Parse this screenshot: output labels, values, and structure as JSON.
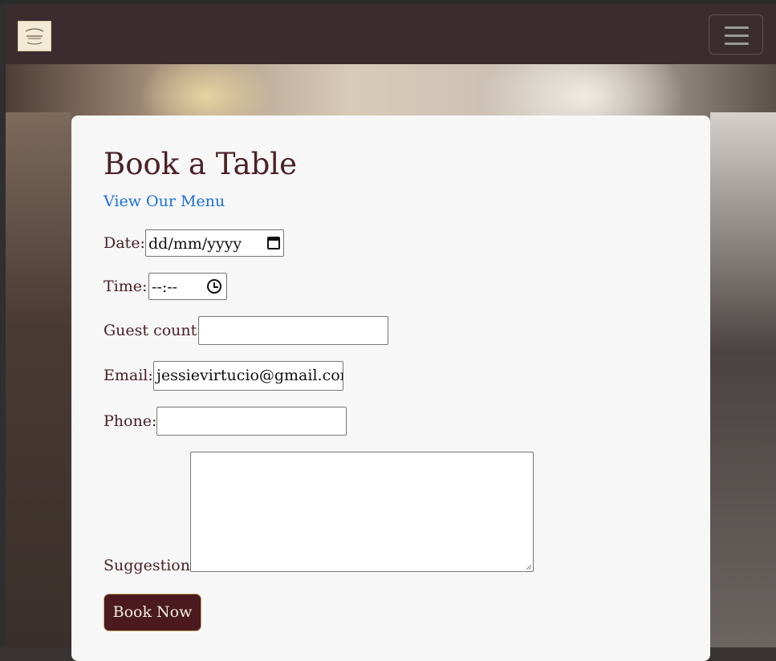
{
  "page": {
    "title": "Book a Table",
    "menu_link": "View Our Menu"
  },
  "navbar": {
    "logo_icon": "restaurant-logo-icon",
    "toggler_icon": "hamburger-menu-icon"
  },
  "form": {
    "date": {
      "label": "Date:",
      "placeholder": "dd/mm/yyyy"
    },
    "time": {
      "label": "Time:",
      "placeholder": "--:--"
    },
    "guest_count": {
      "label": "Guest count:",
      "value": ""
    },
    "email": {
      "label": "Email:",
      "value": "jessievirtucio@gmail.com"
    },
    "phone": {
      "label": "Phone:",
      "value": ""
    },
    "suggestion": {
      "label": "Suggestion:",
      "value": ""
    },
    "submit_label": "Book Now"
  },
  "colors": {
    "navbar_bg": "#3b2d2f",
    "heading": "#4b2025",
    "link": "#1a6fd8",
    "button_bg": "#4a1a1f",
    "button_border": "#c9a86a"
  }
}
